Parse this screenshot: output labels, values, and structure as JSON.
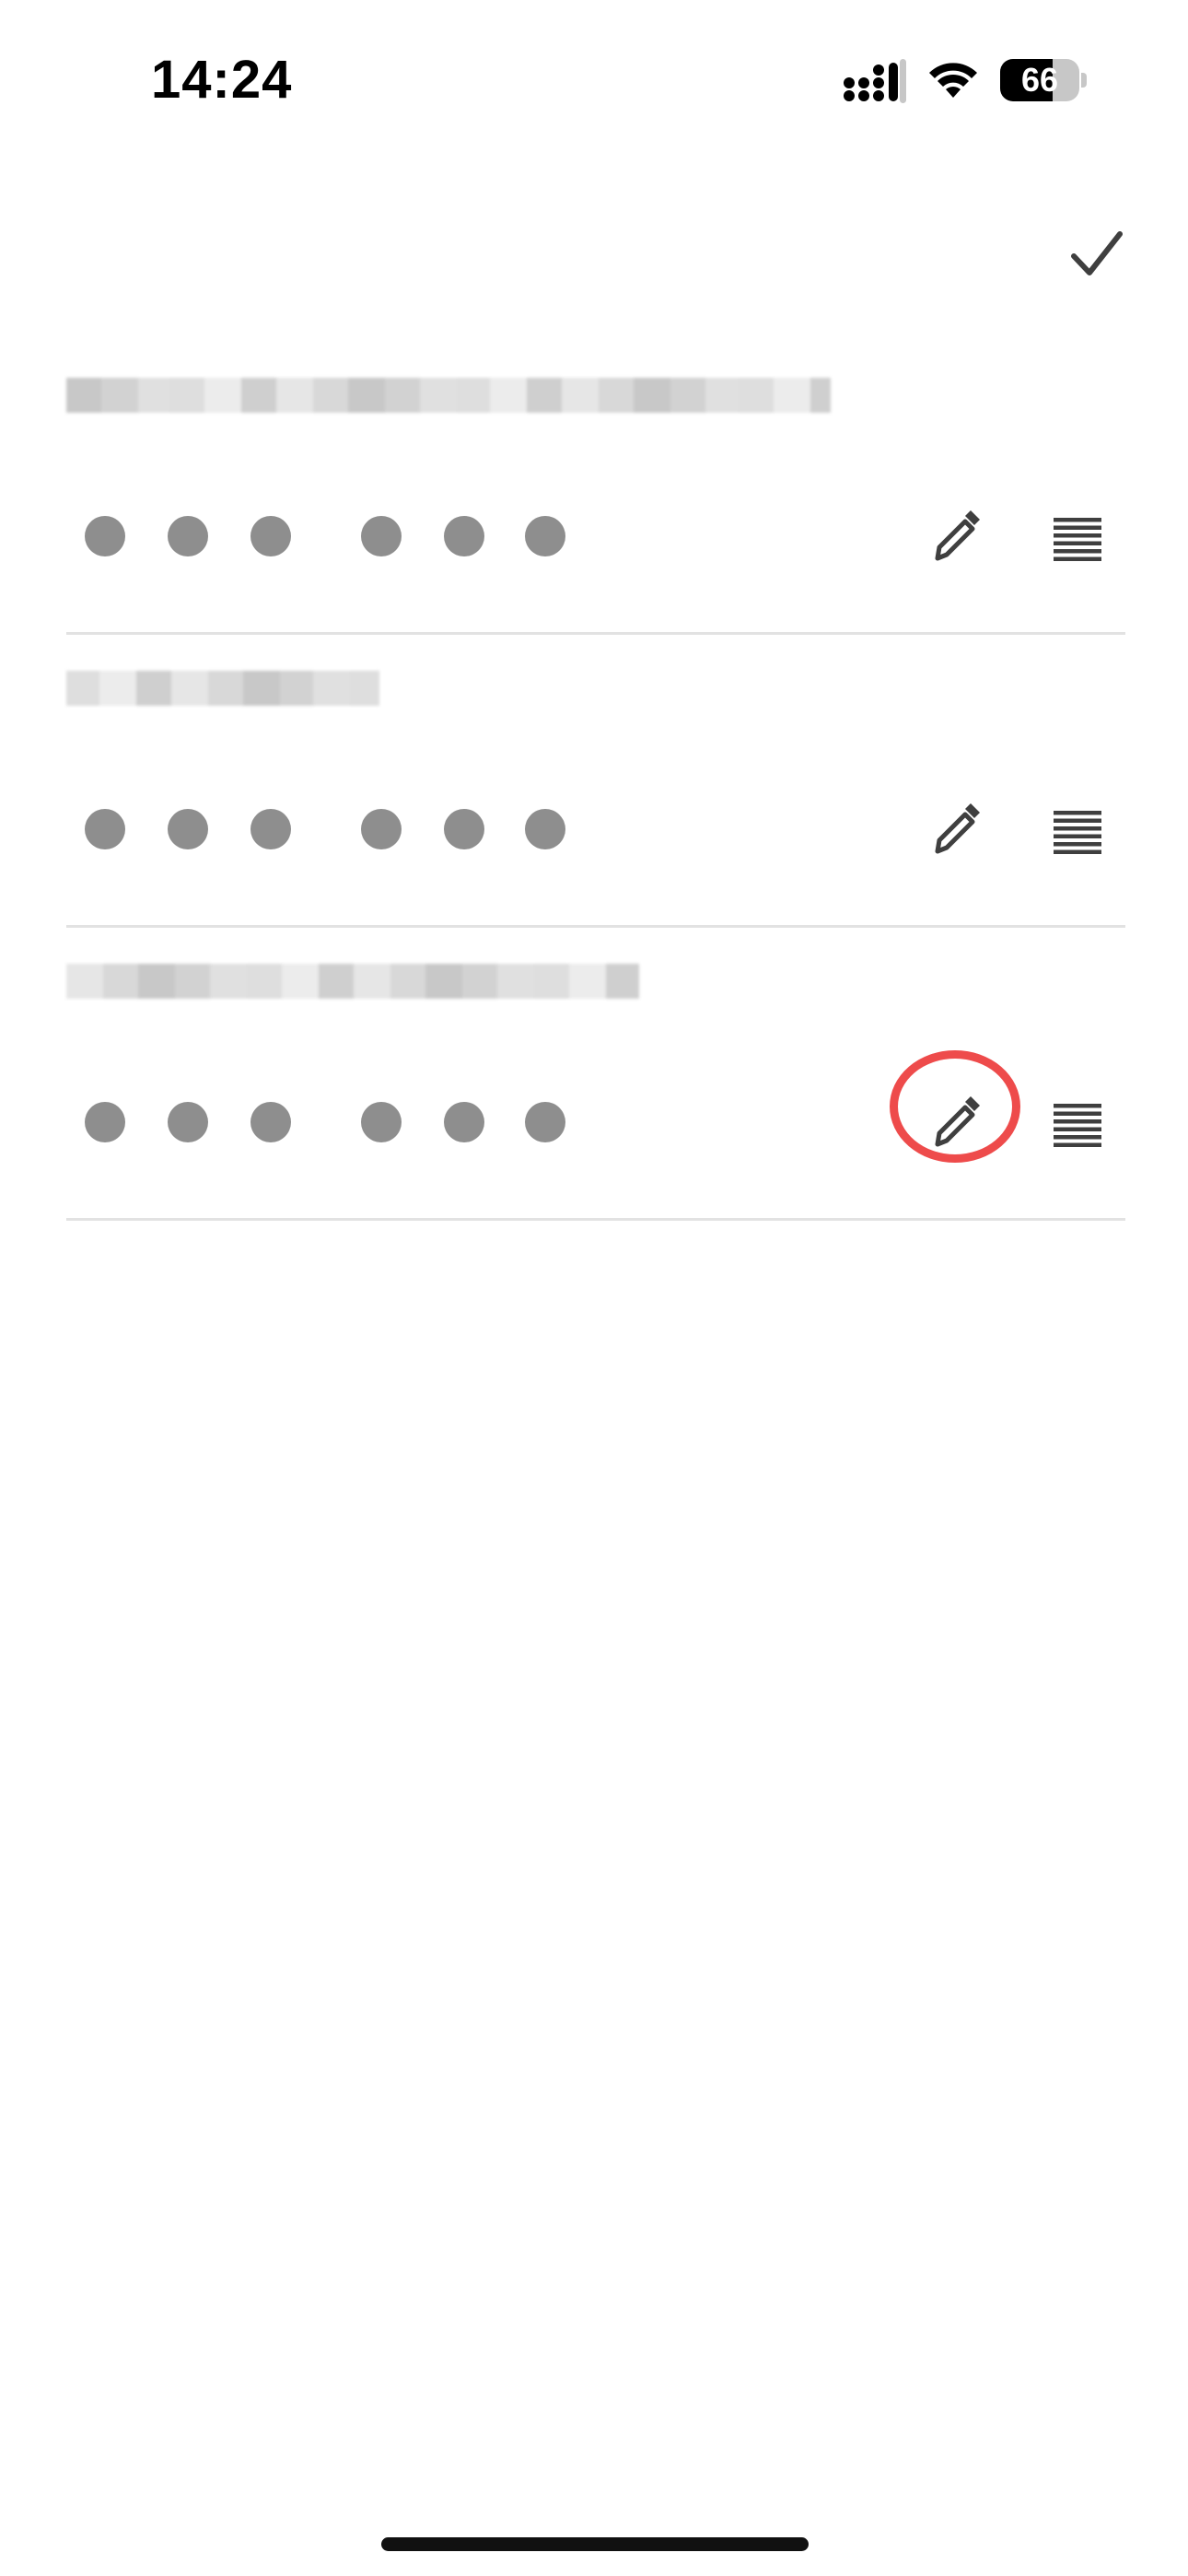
{
  "status_bar": {
    "time": "14:24",
    "battery_level": "66",
    "battery_fraction": 0.66,
    "icons": [
      "signal-icon",
      "wifi-icon",
      "battery-icon"
    ]
  },
  "header": {
    "done_icon": "checkmark-icon"
  },
  "colors": {
    "background": "#ffffff",
    "dot": "#8e8e8e",
    "icon": "#3f3f3f",
    "separator": "#e2e2e2",
    "highlight": "#ee4b4b"
  },
  "rows": [
    {
      "pin_digits": 6,
      "edit_icon": "pencil-icon",
      "reorder_icon": "reorder-handle-icon"
    },
    {
      "pin_digits": 6,
      "edit_icon": "pencil-icon",
      "reorder_icon": "reorder-handle-icon"
    },
    {
      "pin_digits": 6,
      "edit_icon": "pencil-icon",
      "reorder_icon": "reorder-handle-icon",
      "highlighted": true
    }
  ]
}
